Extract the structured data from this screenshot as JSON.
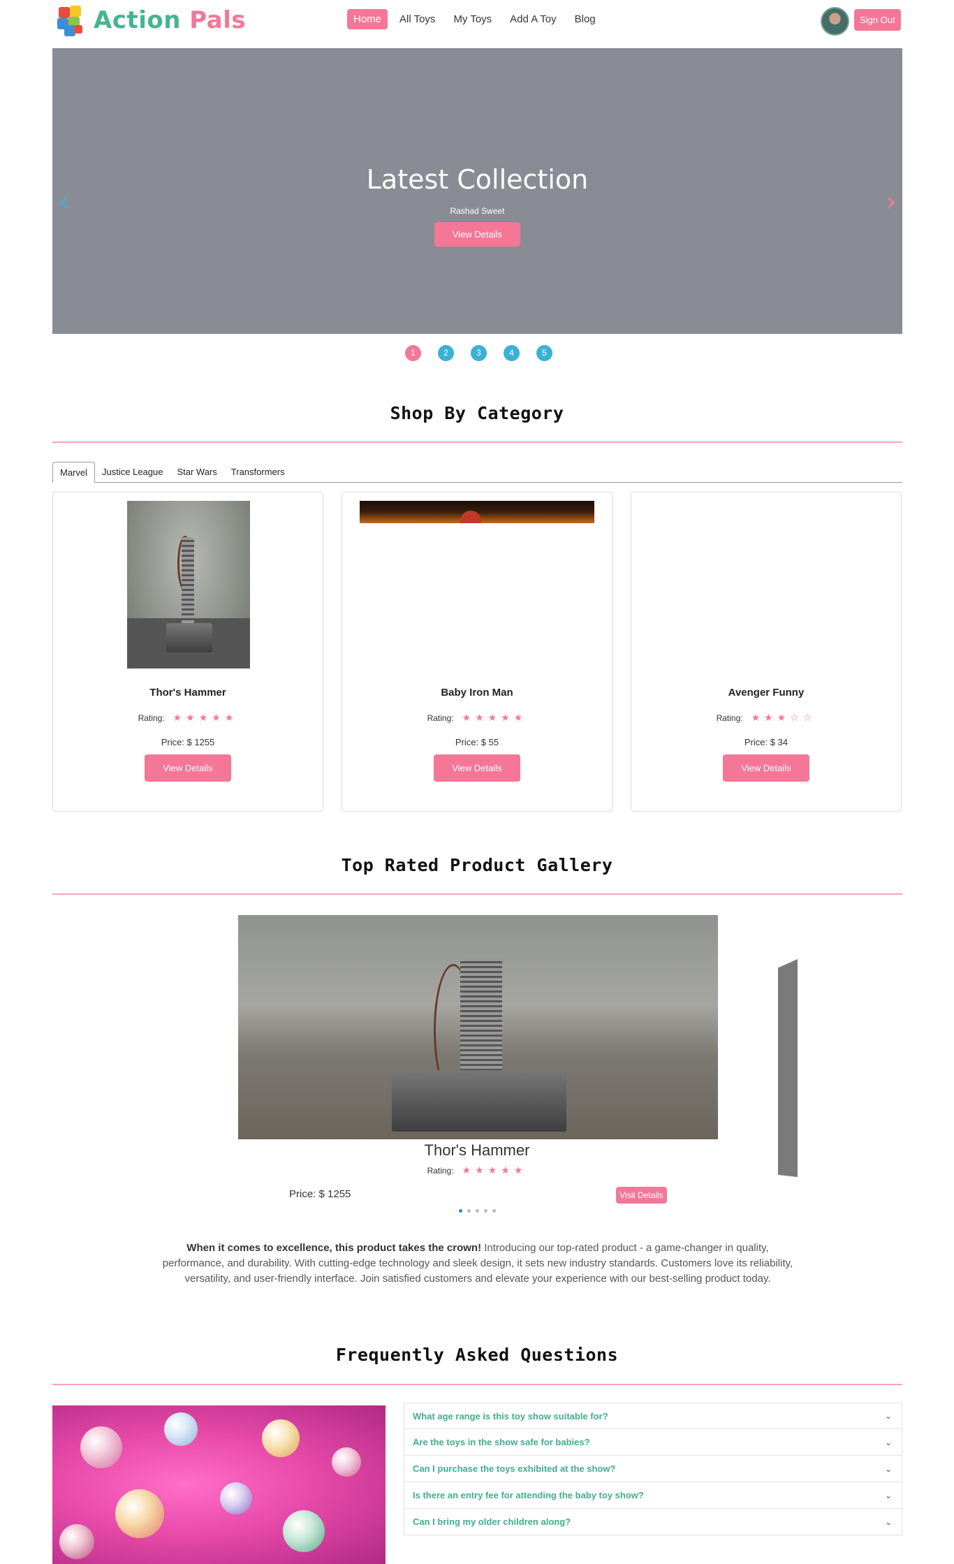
{
  "brand": {
    "name_part1": "Action",
    "name_part2": "Pals"
  },
  "nav": {
    "items": [
      {
        "label": "Home",
        "active": true
      },
      {
        "label": "All Toys",
        "active": false
      },
      {
        "label": "My Toys",
        "active": false
      },
      {
        "label": "Add A Toy",
        "active": false
      },
      {
        "label": "Blog",
        "active": false
      }
    ],
    "signout_label": "Sign Out"
  },
  "hero": {
    "title": "Latest Collection",
    "subtitle": "Rashad Sweet",
    "button_label": "View Details",
    "prev_icon": "‹",
    "next_icon": "›",
    "slides": [
      "1",
      "2",
      "3",
      "4",
      "5"
    ],
    "active_slide": "1"
  },
  "category": {
    "title": "Shop By Category",
    "tabs": [
      "Marvel",
      "Justice League",
      "Star Wars",
      "Transformers"
    ],
    "active_tab": "Marvel",
    "rating_label": "Rating:",
    "products": [
      {
        "name": "Thor's Hammer",
        "rating": 5,
        "stars": "★★★★★",
        "price": "Price: $ 1255",
        "button": "View Details"
      },
      {
        "name": "Baby Iron Man",
        "rating": 5,
        "stars": "★★★★★",
        "price": "Price: $ 55",
        "button": "View Details"
      },
      {
        "name": "Avenger Funny",
        "rating": 3,
        "stars": "★★★☆☆",
        "price": "Price: $ 34",
        "button": "View Details"
      }
    ]
  },
  "gallery": {
    "title": "Top Rated Product Gallery",
    "product_name": "Thor's Hammer",
    "rating_label": "Rating:",
    "stars": "★★★★★",
    "price": "Price: $ 1255",
    "button": "Visit Details",
    "description_bold": "When it comes to excellence, this product takes the crown!",
    "description": " Introducing our top-rated product - a game-changer in quality, performance, and durability. With cutting-edge technology and sleek design, it sets new industry standards. Customers love its reliability, versatility, and user-friendly interface. Join satisfied customers and elevate your experience with our best-selling product today."
  },
  "faq": {
    "title": "Frequently Asked Questions",
    "questions": [
      "What age range is this toy show suitable for?",
      "Are the toys in the show safe for babies?",
      "Can I purchase the toys exhibited at the show?",
      "Is there an entry fee for attending the baby toy show?",
      "Can I bring my older children along?"
    ]
  },
  "colors": {
    "brand_green": "#45b58f",
    "brand_pink": "#f47797",
    "accent_blue": "#3bb1d6",
    "hero_bg": "#898c94"
  }
}
